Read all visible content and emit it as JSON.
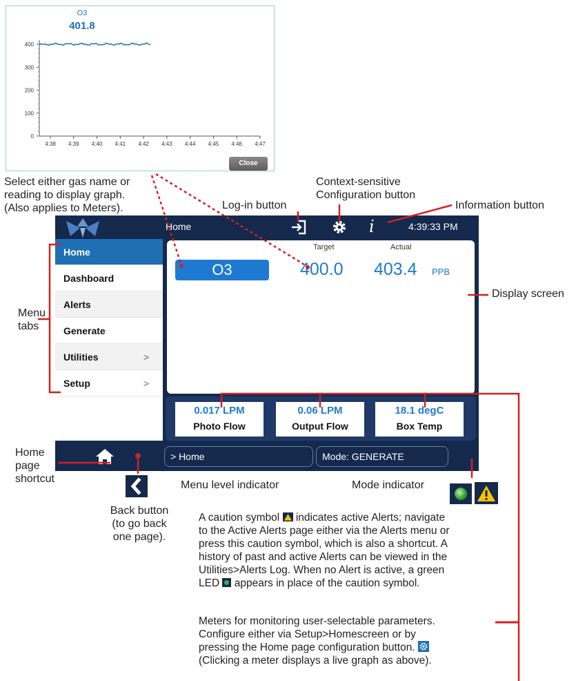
{
  "graph": {
    "gas_name": "O3",
    "reading": "401.8",
    "y_ticks": [
      "400",
      "300",
      "200",
      "100",
      "0"
    ],
    "x_ticks": [
      "4:38",
      "4:39",
      "4:40",
      "4:41",
      "4:42",
      "4:43",
      "4:44",
      "4:45",
      "4:46",
      "4:47"
    ],
    "close_label": "Close",
    "series_color": "#1f6fb5"
  },
  "annotations": {
    "select_gas_line1": "Select either gas name or",
    "select_gas_line2": "reading to display graph.",
    "select_gas_line3": "(Also applies to Meters).",
    "login_button": "Log-in button",
    "config_line1": "Context-sensitive",
    "config_line2": "Configuration button",
    "info_button": "Information button",
    "menu_tabs_1": "Menu",
    "menu_tabs_2": "tabs",
    "display_screen": "Display screen",
    "home_shortcut_1": "Home",
    "home_shortcut_2": "page",
    "home_shortcut_3": "shortcut",
    "menu_level": "Menu level indicator",
    "mode_indicator": "Mode indicator",
    "back_1": "Back button",
    "back_2": "(to go back",
    "back_3": "one page).",
    "caution_1": "A caution symbol",
    "caution_1b": "indicates active Alerts; navigate",
    "caution_2": "to the Active Alerts page either via the Alerts menu or",
    "caution_3": "press this caution symbol, which is also a shortcut. A",
    "caution_4": "history of past and active Alerts can be viewed in the",
    "caution_5": "Utilities>Alerts Log. When no Alert is active, a green",
    "caution_6a": "LED",
    "caution_6b": "appears in place of the caution symbol.",
    "meters_1": "Meters for monitoring user-selectable parameters.",
    "meters_2": "Configure either via Setup>Homescreen or by",
    "meters_3": "pressing the Home page configuration button.",
    "meters_4": "(Clicking a meter displays a live graph as above)."
  },
  "device": {
    "title": "Home",
    "time": "4:39:33 PM",
    "info_glyph": "i",
    "menu": [
      {
        "label": "Home",
        "active": true,
        "chevron": ""
      },
      {
        "label": "Dashboard",
        "active": false,
        "chevron": ""
      },
      {
        "label": "Alerts",
        "active": false,
        "chevron": ""
      },
      {
        "label": "Generate",
        "active": false,
        "chevron": ""
      },
      {
        "label": "Utilities",
        "active": false,
        "chevron": ">"
      },
      {
        "label": "Setup",
        "active": false,
        "chevron": ">"
      }
    ],
    "display": {
      "gas": "O3",
      "target_label": "Target",
      "actual_label": "Actual",
      "target_value": "400.0",
      "actual_value": "403.4",
      "unit": "PPB"
    },
    "meters": [
      {
        "value": "0.017 LPM",
        "label": "Photo Flow"
      },
      {
        "value": "0.06 LPM",
        "label": "Output Flow"
      },
      {
        "value": "18.1 degC",
        "label": "Box Temp"
      }
    ],
    "breadcrumb": "> Home",
    "mode": "Mode: GENERATE"
  },
  "colors": {
    "navy": "#15294d",
    "accent_blue": "#1e7ad0",
    "annotation_red": "#d32020",
    "caution_yellow": "#f5c400",
    "led_green": "#3cb043"
  }
}
